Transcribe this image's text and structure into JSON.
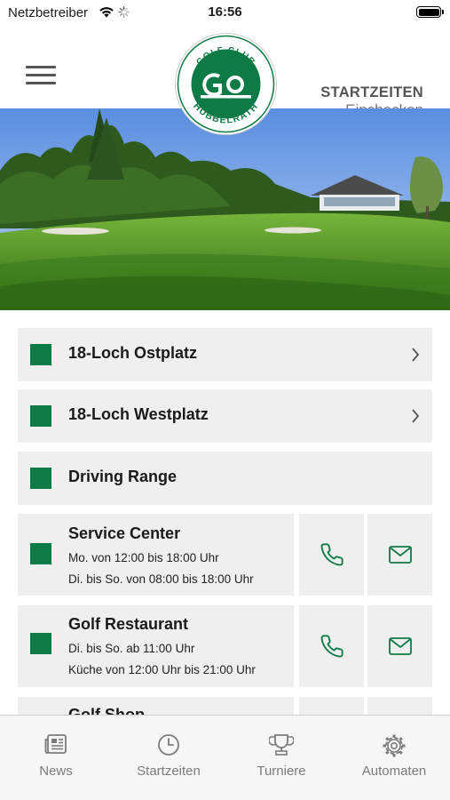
{
  "status_bar": {
    "carrier": "Netzbetreiber",
    "time": "16:56"
  },
  "header": {
    "logo_text": "GOLF CLUB HUBBELRATH",
    "action_title": "STARTZEITEN",
    "action_subtitle": "Einchecken"
  },
  "colors": {
    "brand_green": "#0e7a45",
    "row_bg": "#efefef",
    "tab_gray": "#7b7b7b"
  },
  "list": {
    "items": [
      {
        "title": "18-Loch Ostplatz",
        "chevron": true
      },
      {
        "title": "18-Loch Westplatz",
        "chevron": true
      },
      {
        "title": "Driving Range",
        "chevron": false
      }
    ],
    "contacts": [
      {
        "title": "Service Center",
        "line1": "Mo. von 12:00 bis 18:00 Uhr",
        "line2": "Di. bis So. von 08:00 bis 18:00 Uhr",
        "icons": [
          "phone-icon",
          "mail-icon"
        ]
      },
      {
        "title": "Golf Restaurant",
        "line1": "Di. bis So. ab 11:00 Uhr",
        "line2": "Küche von 12:00 Uhr bis 21:00 Uhr",
        "icons": [
          "phone-icon",
          "mail-icon"
        ]
      },
      {
        "title": "Golf Shop"
      }
    ]
  },
  "tabbar": {
    "tabs": [
      {
        "label": "News",
        "icon": "news-icon"
      },
      {
        "label": "Startzeiten",
        "icon": "clock-icon"
      },
      {
        "label": "Turniere",
        "icon": "trophy-icon"
      },
      {
        "label": "Automaten",
        "icon": "gear-icon"
      }
    ]
  }
}
